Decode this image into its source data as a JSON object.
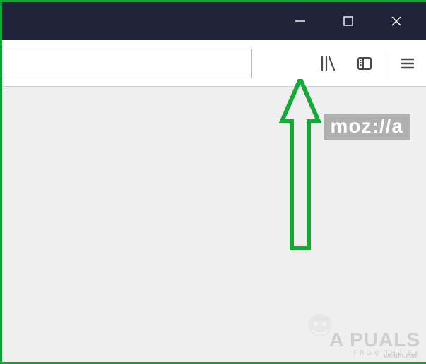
{
  "window": {
    "minimize_label": "Minimize",
    "maximize_label": "Maximize",
    "close_label": "Close"
  },
  "toolbar": {
    "url_value": "",
    "library_label": "Library",
    "sidebar_label": "Sidebar",
    "menu_label": "Menu"
  },
  "content": {
    "mozilla_badge": "moz://a"
  },
  "watermark": {
    "main": "A  PUALS",
    "sub": "FROM  THE  EX",
    "tiny": "wsxdn.com"
  },
  "annotation": {
    "arrow_target": "library-icon"
  }
}
